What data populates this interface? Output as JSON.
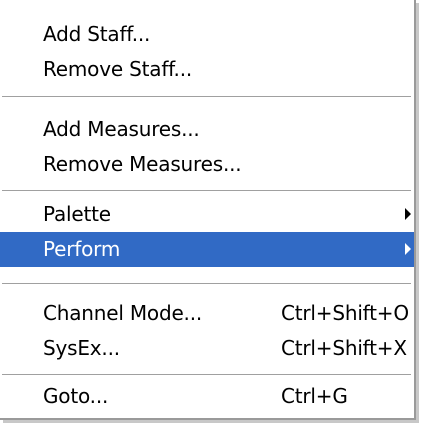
{
  "menu": {
    "items": [
      {
        "label": "Add Staff..."
      },
      {
        "label": "Remove Staff..."
      },
      {
        "label": "Add Measures..."
      },
      {
        "label": "Remove Measures..."
      },
      {
        "label": "Palette",
        "submenu": true
      },
      {
        "label": "Perform",
        "submenu": true,
        "highlighted": true
      },
      {
        "label": "Channel Mode...",
        "shortcut": "Ctrl+Shift+O"
      },
      {
        "label": "SysEx...",
        "shortcut": "Ctrl+Shift+X"
      },
      {
        "label": "Goto...",
        "shortcut": "Ctrl+G"
      }
    ]
  },
  "colors": {
    "highlight": "#316ac5",
    "separator": "#a0a0a0",
    "text": "#000000"
  },
  "icons": {
    "submenu_arrow": "triangle-right-icon"
  }
}
